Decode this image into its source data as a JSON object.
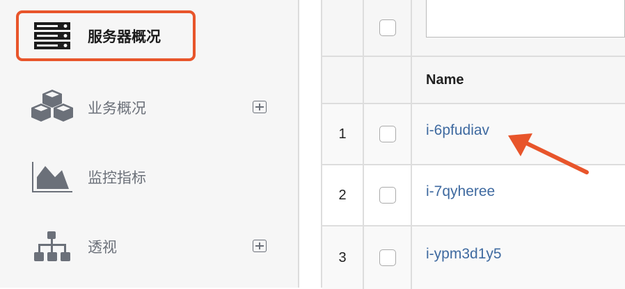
{
  "sidebar": {
    "items": [
      {
        "label": "服务器概况",
        "icon": "server-icon",
        "active": true,
        "expandable": false
      },
      {
        "label": "业务概况",
        "icon": "cubes-icon",
        "active": false,
        "expandable": true
      },
      {
        "label": "监控指标",
        "icon": "area-chart-icon",
        "active": false,
        "expandable": false
      },
      {
        "label": "透视",
        "icon": "sitemap-icon",
        "active": false,
        "expandable": true
      }
    ]
  },
  "table": {
    "filter_value": "",
    "header": {
      "name": "Name"
    },
    "rows": [
      {
        "index": "1",
        "name": "i-6pfudiav"
      },
      {
        "index": "2",
        "name": "i-7qyheree"
      },
      {
        "index": "3",
        "name": "i-ypm3d1y5"
      }
    ]
  },
  "colors": {
    "highlight": "#e8552b",
    "link": "#3f6aa0",
    "icon": "#6b7079"
  }
}
